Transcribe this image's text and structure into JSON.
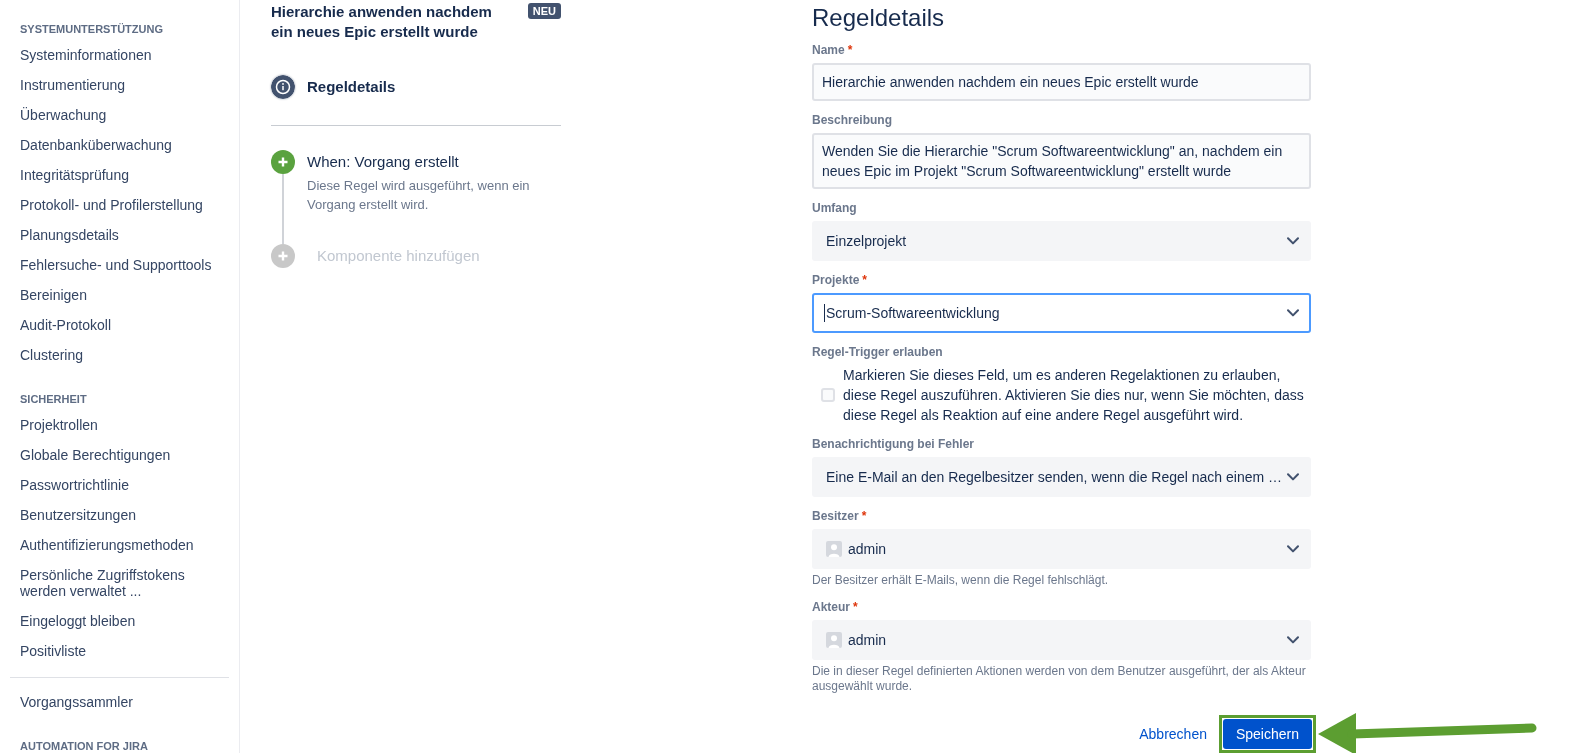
{
  "sidebar": {
    "sections": [
      {
        "heading": "SYSTEMUNTERSTÜTZUNG",
        "items": [
          "Systeminformationen",
          "Instrumentierung",
          "Überwachung",
          "Datenbanküberwachung",
          "Integritätsprüfung",
          "Protokoll- und Profilerstellung",
          "Planungsdetails",
          "Fehlersuche- und Supporttools",
          "Bereinigen",
          "Audit-Protokoll",
          "Clustering"
        ]
      },
      {
        "heading": "SICHERHEIT",
        "items": [
          "Projektrollen",
          "Globale Berechtigungen",
          "Passwortrichtlinie",
          "Benutzersitzungen",
          "Authentifizierungsmethoden",
          "Persönliche Zugriffstokens werden verwaltet ...",
          "Eingeloggt bleiben",
          "Positivliste"
        ]
      },
      {
        "items": [
          "Vorgangssammler"
        ]
      },
      {
        "heading": "AUTOMATION FOR JIRA"
      }
    ]
  },
  "rule": {
    "title": "Hierarchie anwenden nachdem ein neues Epic erstellt wurde",
    "badge": "NEU",
    "steps": [
      {
        "kind": "details",
        "label": "Regeldetails",
        "selected": true
      },
      {
        "kind": "trigger",
        "label": "When: Vorgang erstellt",
        "description": "Diese Regel wird ausgeführt, wenn ein Vorgang erstellt wird.",
        "selected": false
      },
      {
        "kind": "add",
        "label": "Komponente hinzufügen",
        "selected": false
      }
    ]
  },
  "form": {
    "title": "Regeldetails",
    "fields": [
      {
        "kind": "text",
        "label": "Name",
        "required_mark": "*",
        "value": "Hierarchie anwenden nachdem ein neues Epic erstellt wurde",
        "focused": false
      },
      {
        "kind": "textarea",
        "label": "Beschreibung",
        "value": "Wenden Sie die Hierarchie \"Scrum Softwareentwicklung\" an, nachdem ein neues Epic im Projekt \"Scrum Softwareentwicklung\" erstellt wurde",
        "focused": false
      },
      {
        "kind": "select",
        "label": "Umfang",
        "value": "Einzelprojekt",
        "focused": false
      },
      {
        "kind": "select",
        "label": "Projekte",
        "required_mark": "*",
        "value": "Scrum-Softwareentwicklung",
        "focused": true
      },
      {
        "kind": "checkbox",
        "label": "Regel-Trigger erlauben",
        "text": "Markieren Sie dieses Feld, um es anderen Regelaktionen zu erlauben, diese Regel auszuführen. Aktivieren Sie dies nur, wenn Sie möchten, dass diese Regel als Reaktion auf eine andere Regel ausgeführt wird.",
        "checked": false,
        "focused": false
      },
      {
        "kind": "select",
        "label": "Benachrichtigung bei Fehler",
        "value": "Eine E-Mail an den Regelbesitzer senden, wenn die Regel nach einem …",
        "focused": false
      },
      {
        "kind": "user",
        "label": "Besitzer",
        "required_mark": "*",
        "value": "admin",
        "help": "Der Besitzer erhält E-Mails, wenn die Regel fehlschlägt.",
        "focused": false
      },
      {
        "kind": "user",
        "label": "Akteur",
        "required_mark": "*",
        "value": "admin",
        "help": "Die in dieser Regel definierten Aktionen werden von dem Benutzer ausgeführt, der als Akteur ausgewählt wurde.",
        "focused": false
      }
    ],
    "actions": [
      {
        "kind": "link",
        "label": "Abbrechen",
        "highlighted": false
      },
      {
        "kind": "primary",
        "label": "Speichern",
        "highlighted": true
      }
    ]
  }
}
